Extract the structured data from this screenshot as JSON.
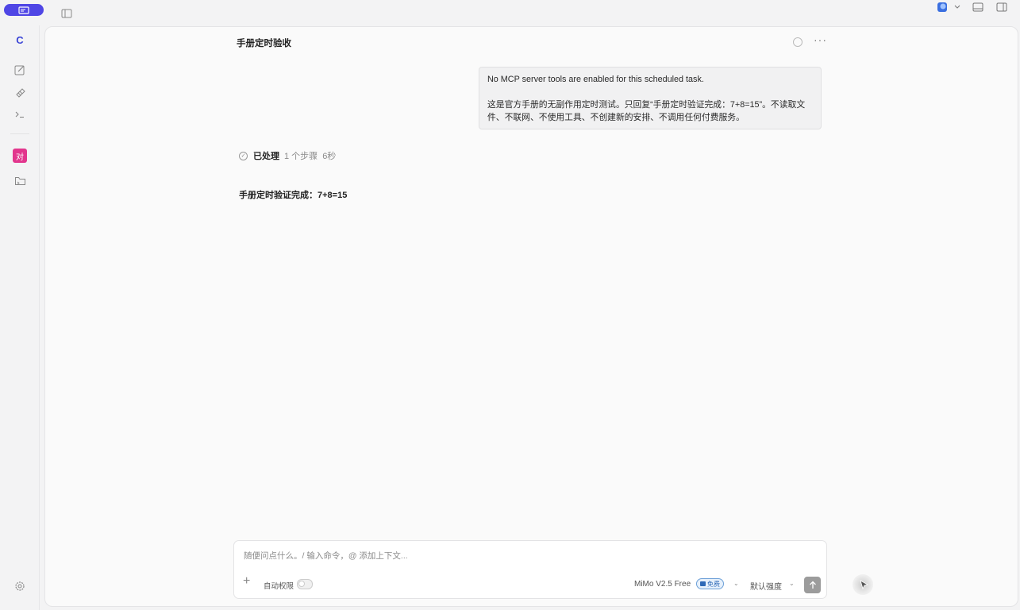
{
  "chat": {
    "title": "手册定时验收"
  },
  "user_message": {
    "line1": "No MCP server tools are enabled for this scheduled task.",
    "line2": "这是官方手册的无副作用定时测试。只回复“手册定时验证完成：7+8=15”。不读取文件、不联网、不使用工具、不创建新的安排、不调用任何付费服务。"
  },
  "processed": {
    "label": "已处理",
    "steps": "1 个步骤",
    "duration": "6秒"
  },
  "answer": {
    "text": "手册定时验证完成：7+8=15"
  },
  "composer": {
    "placeholder": "随便问点什么。/ 输入命令，@ 添加上下文...",
    "auto_permission_label": "自动权限",
    "model_name": "MiMo V2.5 Free",
    "free_badge": "免费",
    "intensity_label": "默认强度"
  },
  "rail": {
    "workspace_letter": "C",
    "badge_text": "对"
  },
  "colors": {
    "accent": "#4f46e5",
    "badge_pink": "#e2368d",
    "send_button": "#9c9c9c"
  },
  "icons": [
    "app-icon",
    "sidebar-toggle-icon",
    "avatar-icon",
    "chevron-down-icon",
    "bottom-panel-icon",
    "right-panel-icon",
    "new-chat-icon",
    "skills-icon",
    "terminal-icon",
    "folder-icon",
    "settings-icon",
    "spinner-icon",
    "more-icon",
    "check-icon",
    "plus-icon",
    "send-icon",
    "cursor-icon"
  ]
}
